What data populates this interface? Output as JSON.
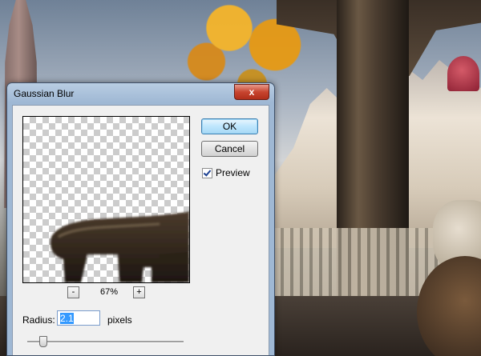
{
  "dialog": {
    "title": "Gaussian Blur",
    "close_label": "x",
    "ok_label": "OK",
    "cancel_label": "Cancel",
    "preview_checkbox": {
      "label": "Preview",
      "checked": true
    },
    "zoom": {
      "minus_label": "-",
      "plus_label": "+",
      "level": "67%"
    },
    "radius": {
      "label": "Radius:",
      "value": "2.1",
      "units": "pixels"
    },
    "slider": {
      "level": 0.1
    }
  },
  "colors": {
    "ok_border": "#3c7fb1",
    "close_red": "#c7442f",
    "selection_blue": "#3399ff"
  }
}
